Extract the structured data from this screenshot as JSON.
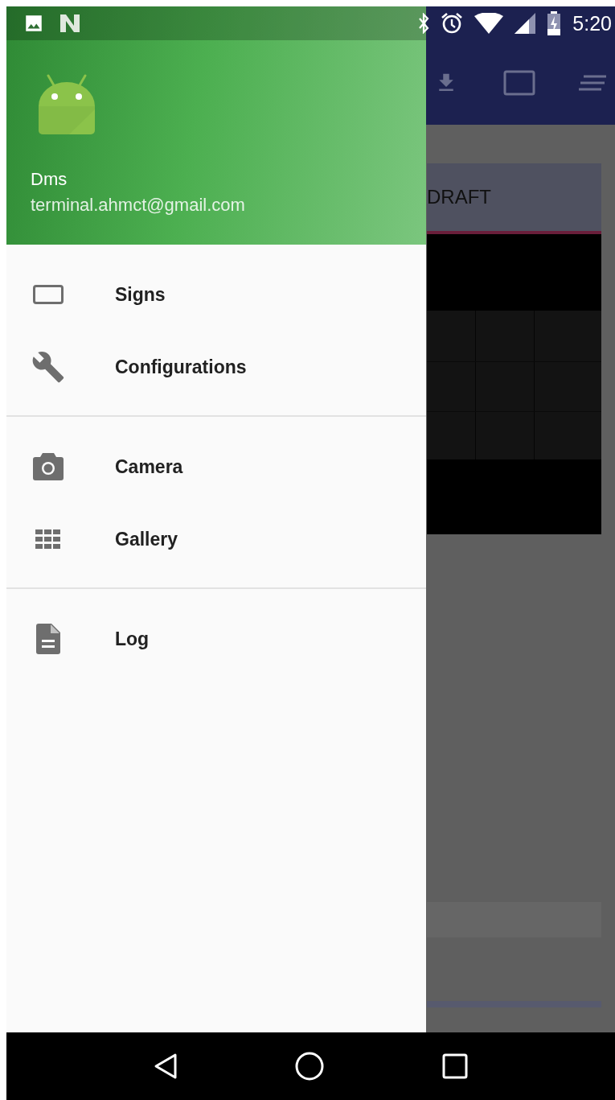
{
  "status_bar": {
    "time": "5:20"
  },
  "drawer": {
    "header": {
      "name": "Dms",
      "email": "terminal.ahmct@gmail.com"
    },
    "sections": [
      {
        "items": [
          {
            "label": "Signs"
          },
          {
            "label": "Configurations"
          }
        ]
      },
      {
        "items": [
          {
            "label": "Camera"
          },
          {
            "label": "Gallery"
          }
        ]
      },
      {
        "items": [
          {
            "label": "Log"
          }
        ]
      }
    ]
  },
  "background_app": {
    "card_title": "DRAFT"
  }
}
